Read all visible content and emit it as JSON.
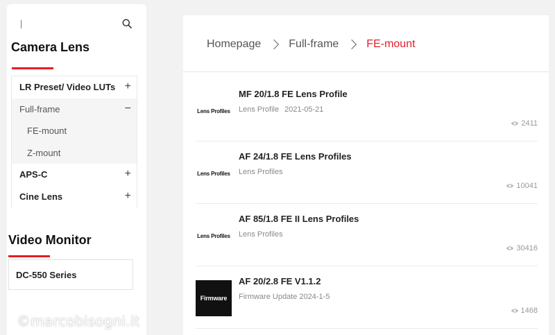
{
  "sidebar": {
    "search": {
      "placeholder": ""
    },
    "category_title": "Camera Lens",
    "menu": [
      {
        "label": "LR Preset/ Video LUTs",
        "toggle": "+"
      },
      {
        "label": "Full-frame",
        "toggle": "−"
      },
      {
        "label": "FE-mount"
      },
      {
        "label": "Z-mount"
      },
      {
        "label": "APS-C",
        "toggle": "+"
      },
      {
        "label": "Cine Lens",
        "toggle": "+"
      }
    ],
    "video_monitor_title": "Video Monitor",
    "video_monitor_items": [
      {
        "label": "DC-550 Series"
      }
    ]
  },
  "watermark": "©marcobisogni.it",
  "breadcrumb": [
    {
      "label": "Homepage"
    },
    {
      "label": "Full-frame"
    },
    {
      "label": "FE-mount"
    }
  ],
  "items": [
    {
      "thumb": "Lens Profiles",
      "thumb_style": "light",
      "title": "MF 20/1.8 FE Lens Profile",
      "category": "Lens Profile",
      "date": "2021-05-21",
      "views": "2411"
    },
    {
      "thumb": "Lens Profiles",
      "thumb_style": "light",
      "title": "AF 24/1.8 FE Lens Profiles",
      "category": "Lens Profiles",
      "date": "",
      "views": "10041"
    },
    {
      "thumb": "Lens Profiles",
      "thumb_style": "light",
      "title": "AF 85/1.8 FE II Lens Profiles",
      "category": "Lens Profiles",
      "date": "",
      "views": "30416"
    },
    {
      "thumb": "Firmware",
      "thumb_style": "dark",
      "title": "AF 20/2.8 FE V1.1.2",
      "category": "Firmware Update",
      "date": "2024-1-5",
      "views": "1468"
    }
  ],
  "colors": {
    "accent": "#e41e26",
    "background": "#f2f2f2"
  },
  "icons": {
    "search": "search-icon",
    "views": "eye-icon"
  }
}
